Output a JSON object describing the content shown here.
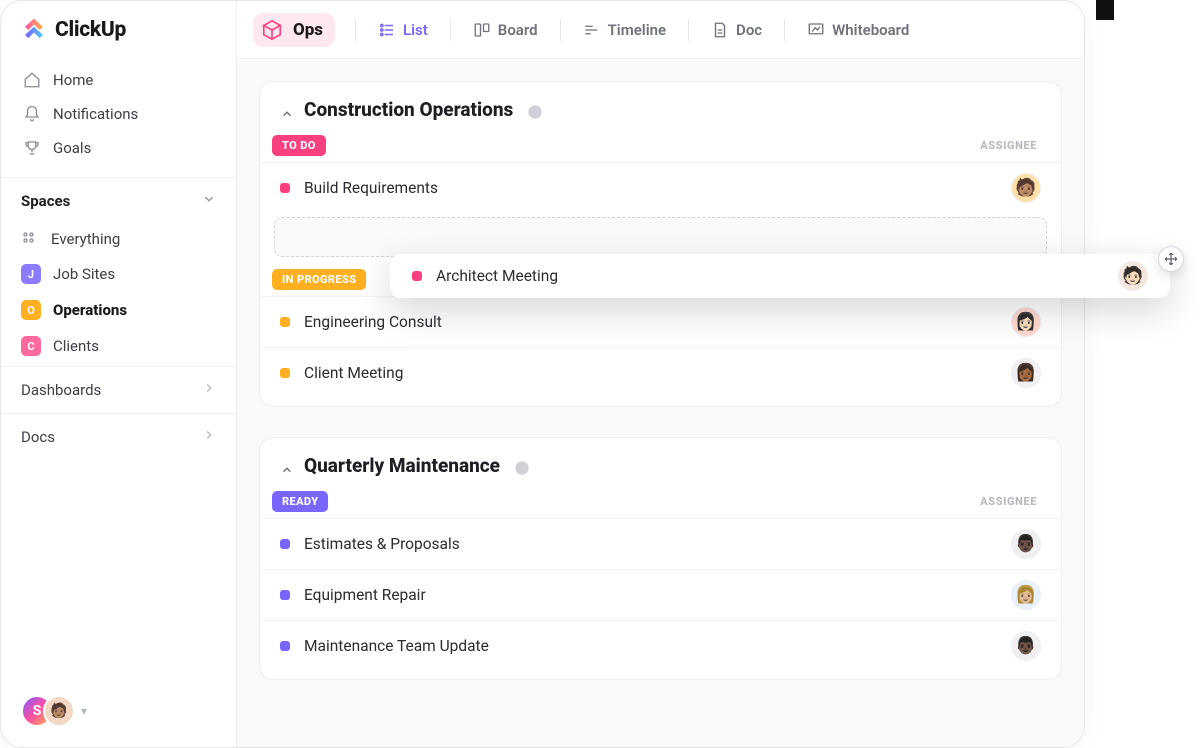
{
  "brand": {
    "name": "ClickUp"
  },
  "sidebar": {
    "nav": [
      {
        "label": "Home",
        "icon": "home-icon"
      },
      {
        "label": "Notifications",
        "icon": "bell-icon"
      },
      {
        "label": "Goals",
        "icon": "trophy-icon"
      }
    ],
    "spaces_header": "Spaces",
    "spaces": [
      {
        "label": "Everything",
        "icon": "grid"
      },
      {
        "label": "Job Sites",
        "chip": "J",
        "color": "#8a7bff"
      },
      {
        "label": "Operations",
        "chip": "O",
        "color": "#ffb020",
        "active": true
      },
      {
        "label": "Clients",
        "chip": "C",
        "color": "#ff6a9e"
      }
    ],
    "collapsibles": [
      {
        "label": "Dashboards"
      },
      {
        "label": "Docs"
      }
    ],
    "user_initial": "S"
  },
  "topbar": {
    "space": {
      "name": "Ops",
      "color": "#f8417e"
    },
    "views": [
      {
        "label": "List",
        "active": true
      },
      {
        "label": "Board"
      },
      {
        "label": "Timeline"
      },
      {
        "label": "Doc"
      },
      {
        "label": "Whiteboard"
      }
    ]
  },
  "lists": [
    {
      "title": "Construction Operations",
      "groups": [
        {
          "status": "TO DO",
          "chip_class": "todo",
          "assignee_header": "ASSIGNEE",
          "tasks": [
            {
              "name": "Build Requirements",
              "dot": "dot-todo",
              "avatar_bg": "#ffe1a8",
              "avatar_face": "🧑🏽"
            }
          ],
          "has_dropzone": true
        },
        {
          "status": "IN PROGRESS",
          "chip_class": "progress",
          "tasks": [
            {
              "name": "Engineering Consult",
              "dot": "dot-progress",
              "avatar_bg": "#ffd9d0",
              "avatar_face": "👩🏻"
            },
            {
              "name": "Client Meeting",
              "dot": "dot-progress",
              "avatar_bg": "#f0f0f2",
              "avatar_face": "👩🏾"
            }
          ]
        }
      ]
    },
    {
      "title": "Quarterly Maintenance",
      "groups": [
        {
          "status": "READY",
          "chip_class": "ready",
          "assignee_header": "ASSIGNEE",
          "tasks": [
            {
              "name": "Estimates & Proposals",
              "dot": "dot-ready",
              "avatar_bg": "#f0f0f2",
              "avatar_face": "👨🏿"
            },
            {
              "name": "Equipment Repair",
              "dot": "dot-ready",
              "avatar_bg": "#e9f1ff",
              "avatar_face": "👩🏼"
            },
            {
              "name": "Maintenance Team Update",
              "dot": "dot-ready",
              "avatar_bg": "#f0f0f2",
              "avatar_face": "👨🏿"
            }
          ]
        }
      ]
    }
  ],
  "dragged_task": {
    "name": "Architect Meeting",
    "dot": "dot-todo",
    "avatar_bg": "#f6e7df",
    "avatar_face": "🧑🏻"
  }
}
